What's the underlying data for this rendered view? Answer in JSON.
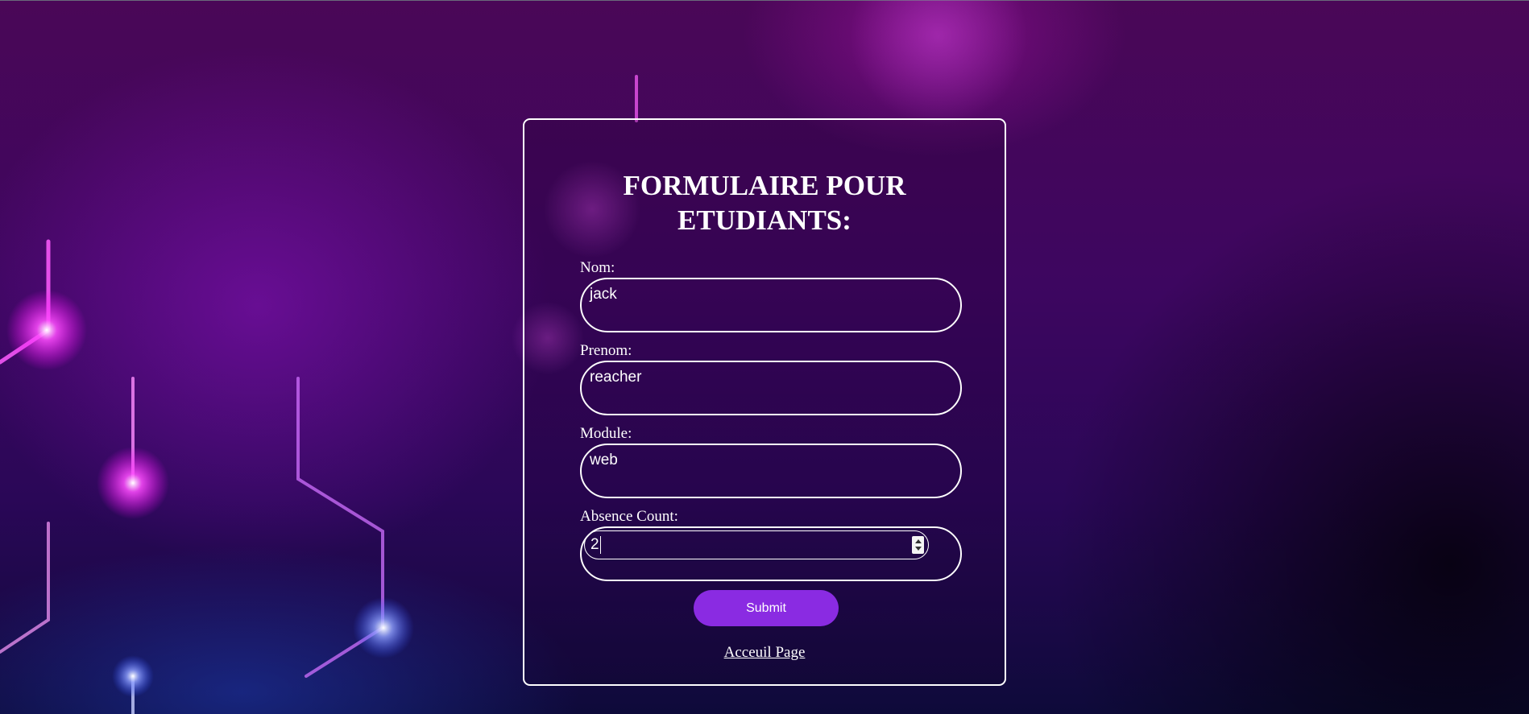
{
  "page": {
    "title": "FORMULAIRE POUR ETUDIANTS:"
  },
  "form": {
    "fields": [
      {
        "label": "Nom:",
        "value": "jack"
      },
      {
        "label": "Prenom:",
        "value": "reacher"
      },
      {
        "label": "Module:",
        "value": "web"
      },
      {
        "label": "Absence Count:",
        "value": "2"
      }
    ],
    "submit_label": "Submit",
    "home_link_label": "Acceuil Page"
  },
  "theme": {
    "accent": "#8a2be2",
    "border": "#ffffff",
    "text": "#ffffff"
  }
}
